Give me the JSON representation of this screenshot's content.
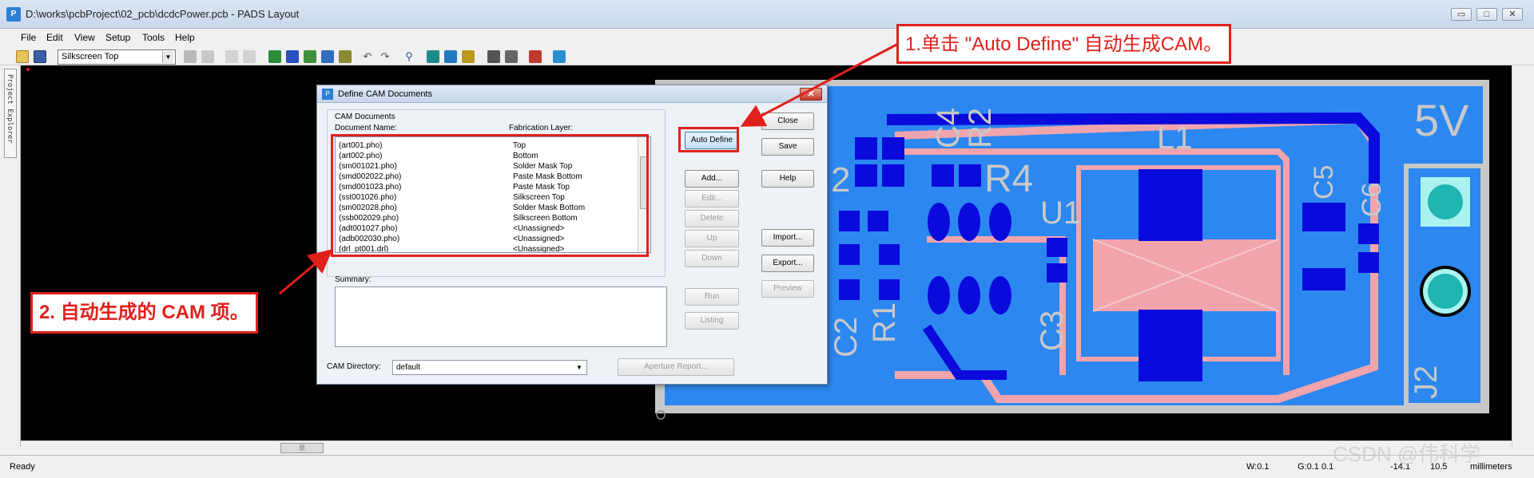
{
  "window": {
    "title": "D:\\works\\pcbProject\\02_pcb\\dcdcPower.pcb - PADS Layout",
    "minimize": "▭",
    "maximize": "□",
    "close": "✕"
  },
  "menu": [
    "File",
    "Edit",
    "View",
    "Setup",
    "Tools",
    "Help"
  ],
  "toolbar": {
    "layer": "Silkscreen Top",
    "icons": [
      "open-icon",
      "save-icon",
      "properties-icon",
      "refresh-icon",
      "route-icon",
      "grid-icon",
      "pour-icon",
      "split-icon",
      "undo-icon",
      "redo-icon",
      "zoom-icon",
      "drc-icon",
      "check-icon",
      "highlight-icon",
      "report-icon",
      "window-icon",
      "spell-icon",
      "wizard-icon"
    ]
  },
  "left_panel": {
    "tab": "Project Explorer"
  },
  "dialog": {
    "title": "Define CAM Documents",
    "close_glyph": "✕",
    "group_label": "CAM Documents",
    "col_doc": "Document Name:",
    "col_layer": "Fabrication Layer:",
    "rows": [
      {
        "name": "(art001.pho)",
        "layer": "Top"
      },
      {
        "name": "(art002.pho)",
        "layer": "Bottom"
      },
      {
        "name": "(sm001021.pho)",
        "layer": "Solder Mask Top"
      },
      {
        "name": "(smd002022.pho)",
        "layer": "Paste Mask Bottom"
      },
      {
        "name": "(smd001023.pho)",
        "layer": "Paste Mask Top"
      },
      {
        "name": "(sst001026.pho)",
        "layer": "Silkscreen Top"
      },
      {
        "name": "(sm002028.pho)",
        "layer": "Solder Mask Bottom"
      },
      {
        "name": "(ssb002029.pho)",
        "layer": "Silkscreen Bottom"
      },
      {
        "name": "(adt001027.pho)",
        "layer": "<Unassigned>"
      },
      {
        "name": "(adb002030.pho)",
        "layer": "<Unassigned>"
      },
      {
        "name": "(drl_pt001.drl)",
        "layer": "<Unassigned>"
      }
    ],
    "buttons": {
      "auto_define": "Auto Define",
      "add": "Add...",
      "edit": "Edit...",
      "delete": "Delete",
      "up": "Up",
      "down": "Down",
      "run": "Run",
      "listing": "Listing",
      "close": "Close",
      "save": "Save",
      "help": "Help",
      "import": "Import...",
      "export": "Export...",
      "preview": "Preview",
      "aperture_report": "Aperture Report..."
    },
    "summary_label": "Summary:",
    "cam_dir_label": "CAM Directory:",
    "cam_dir_value": "default"
  },
  "pcb": {
    "labels": {
      "vout": "5V",
      "inductor": "L1",
      "u1": "U1",
      "r4": "R4",
      "r1": "R1",
      "c2": "C2",
      "c3": "C3",
      "c5": "C5",
      "c6": "C6",
      "j2": "J2",
      "c_top": "C4",
      "r_top": "R2",
      "two": "2"
    },
    "colors": {
      "board": "#2c87f0",
      "copper": "#0a0adc",
      "silk": "#f2a4ad",
      "pad": "#1fb5b0",
      "outline": "#c8c8c8"
    }
  },
  "annotations": {
    "step1": "1.单击 \"Auto Define\" 自动生成CAM。",
    "step2": "2. 自动生成的 CAM 项。"
  },
  "status": {
    "ready": "Ready",
    "width": "W:0.1",
    "grid": "G:0.1 0.1",
    "x": "-14.1",
    "y": "10.5",
    "units": "millimeters",
    "watermark": "CSDN @伟科学"
  }
}
